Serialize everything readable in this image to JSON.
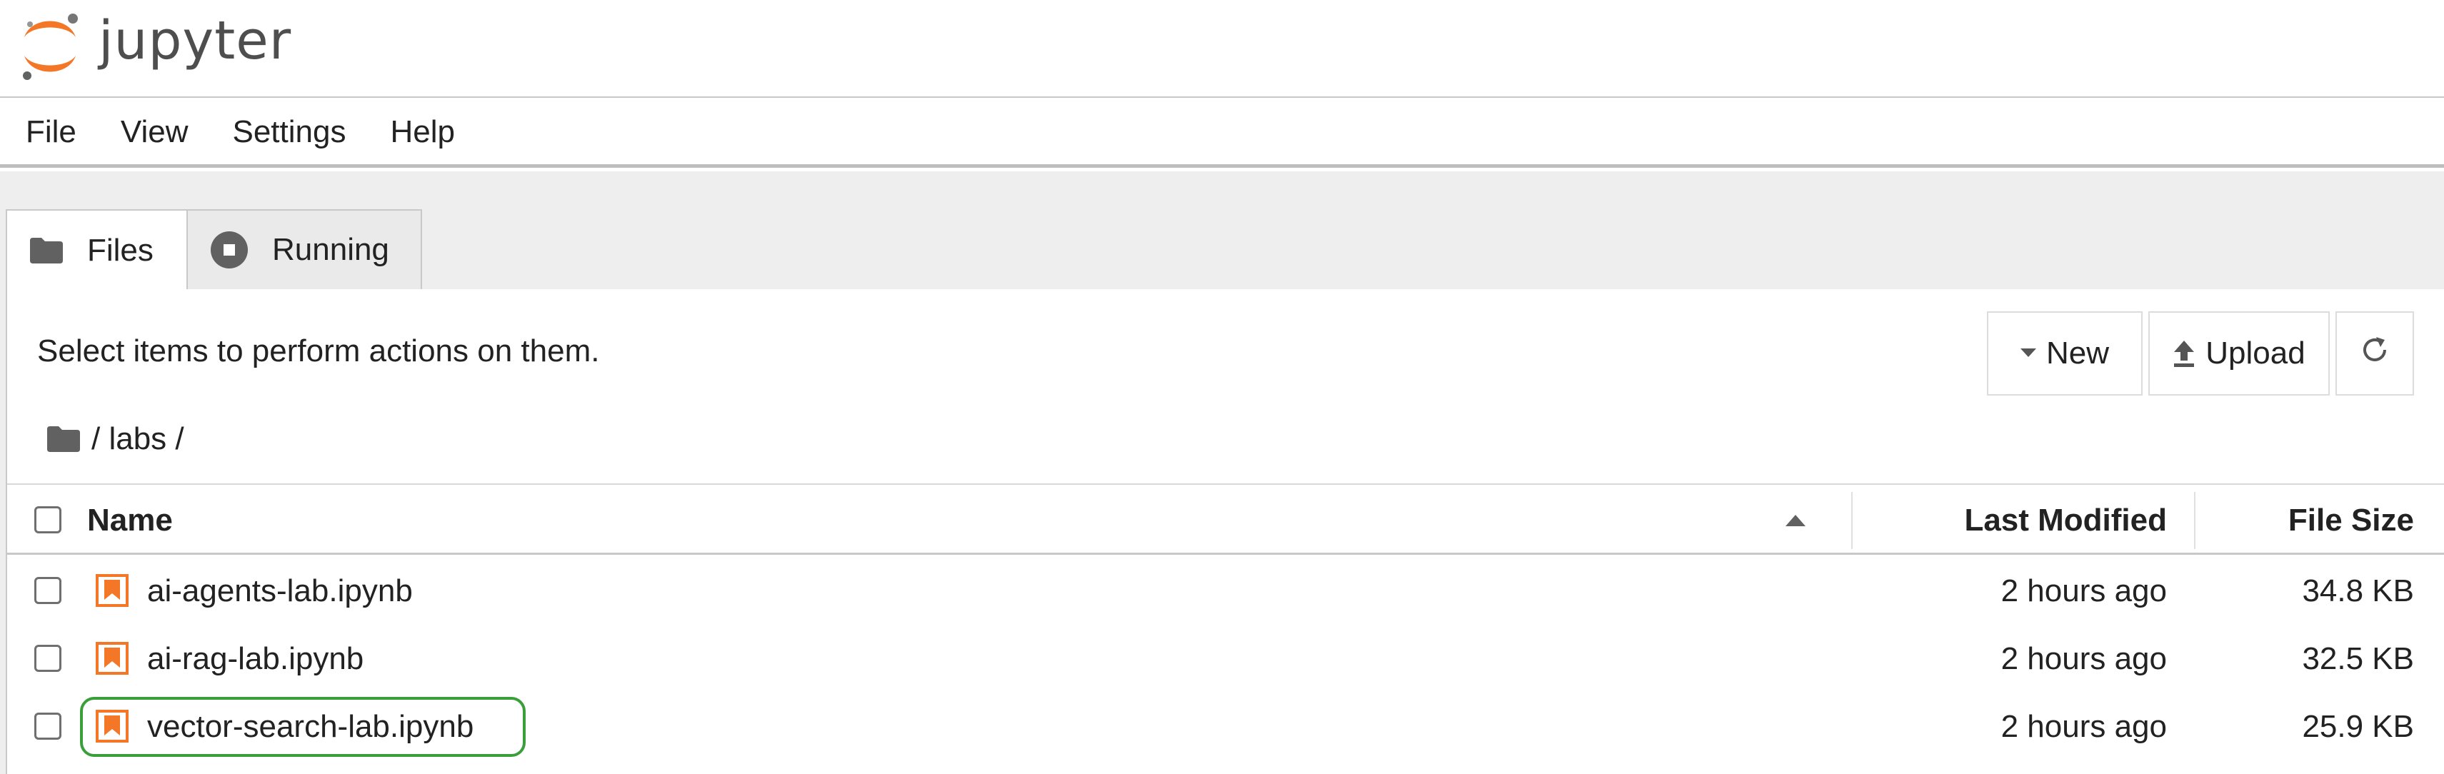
{
  "app": {
    "logo_text": "jupyter"
  },
  "menu": {
    "items": [
      "File",
      "View",
      "Settings",
      "Help"
    ]
  },
  "tabs": [
    {
      "label": "Files",
      "icon": "folder-icon",
      "active": true
    },
    {
      "label": "Running",
      "icon": "stop-circle-icon",
      "active": false
    }
  ],
  "browser": {
    "hint": "Select items to perform actions on them.",
    "buttons": {
      "new": "New",
      "upload": "Upload",
      "refresh_icon": "refresh-icon"
    },
    "breadcrumb": "/ labs /",
    "columns": {
      "name": "Name",
      "modified": "Last Modified",
      "size": "File Size"
    },
    "files": [
      {
        "name": "ai-agents-lab.ipynb",
        "modified": "2 hours ago",
        "size": "34.8 KB",
        "icon": "notebook-icon"
      },
      {
        "name": "ai-rag-lab.ipynb",
        "modified": "2 hours ago",
        "size": "32.5 KB",
        "icon": "notebook-icon"
      },
      {
        "name": "vector-search-lab.ipynb",
        "modified": "2 hours ago",
        "size": "25.9 KB",
        "icon": "notebook-icon",
        "highlighted": true
      }
    ]
  },
  "colors": {
    "accent": "#f37726",
    "highlight": "#3a9f3a",
    "icon_grey": "#616161"
  }
}
